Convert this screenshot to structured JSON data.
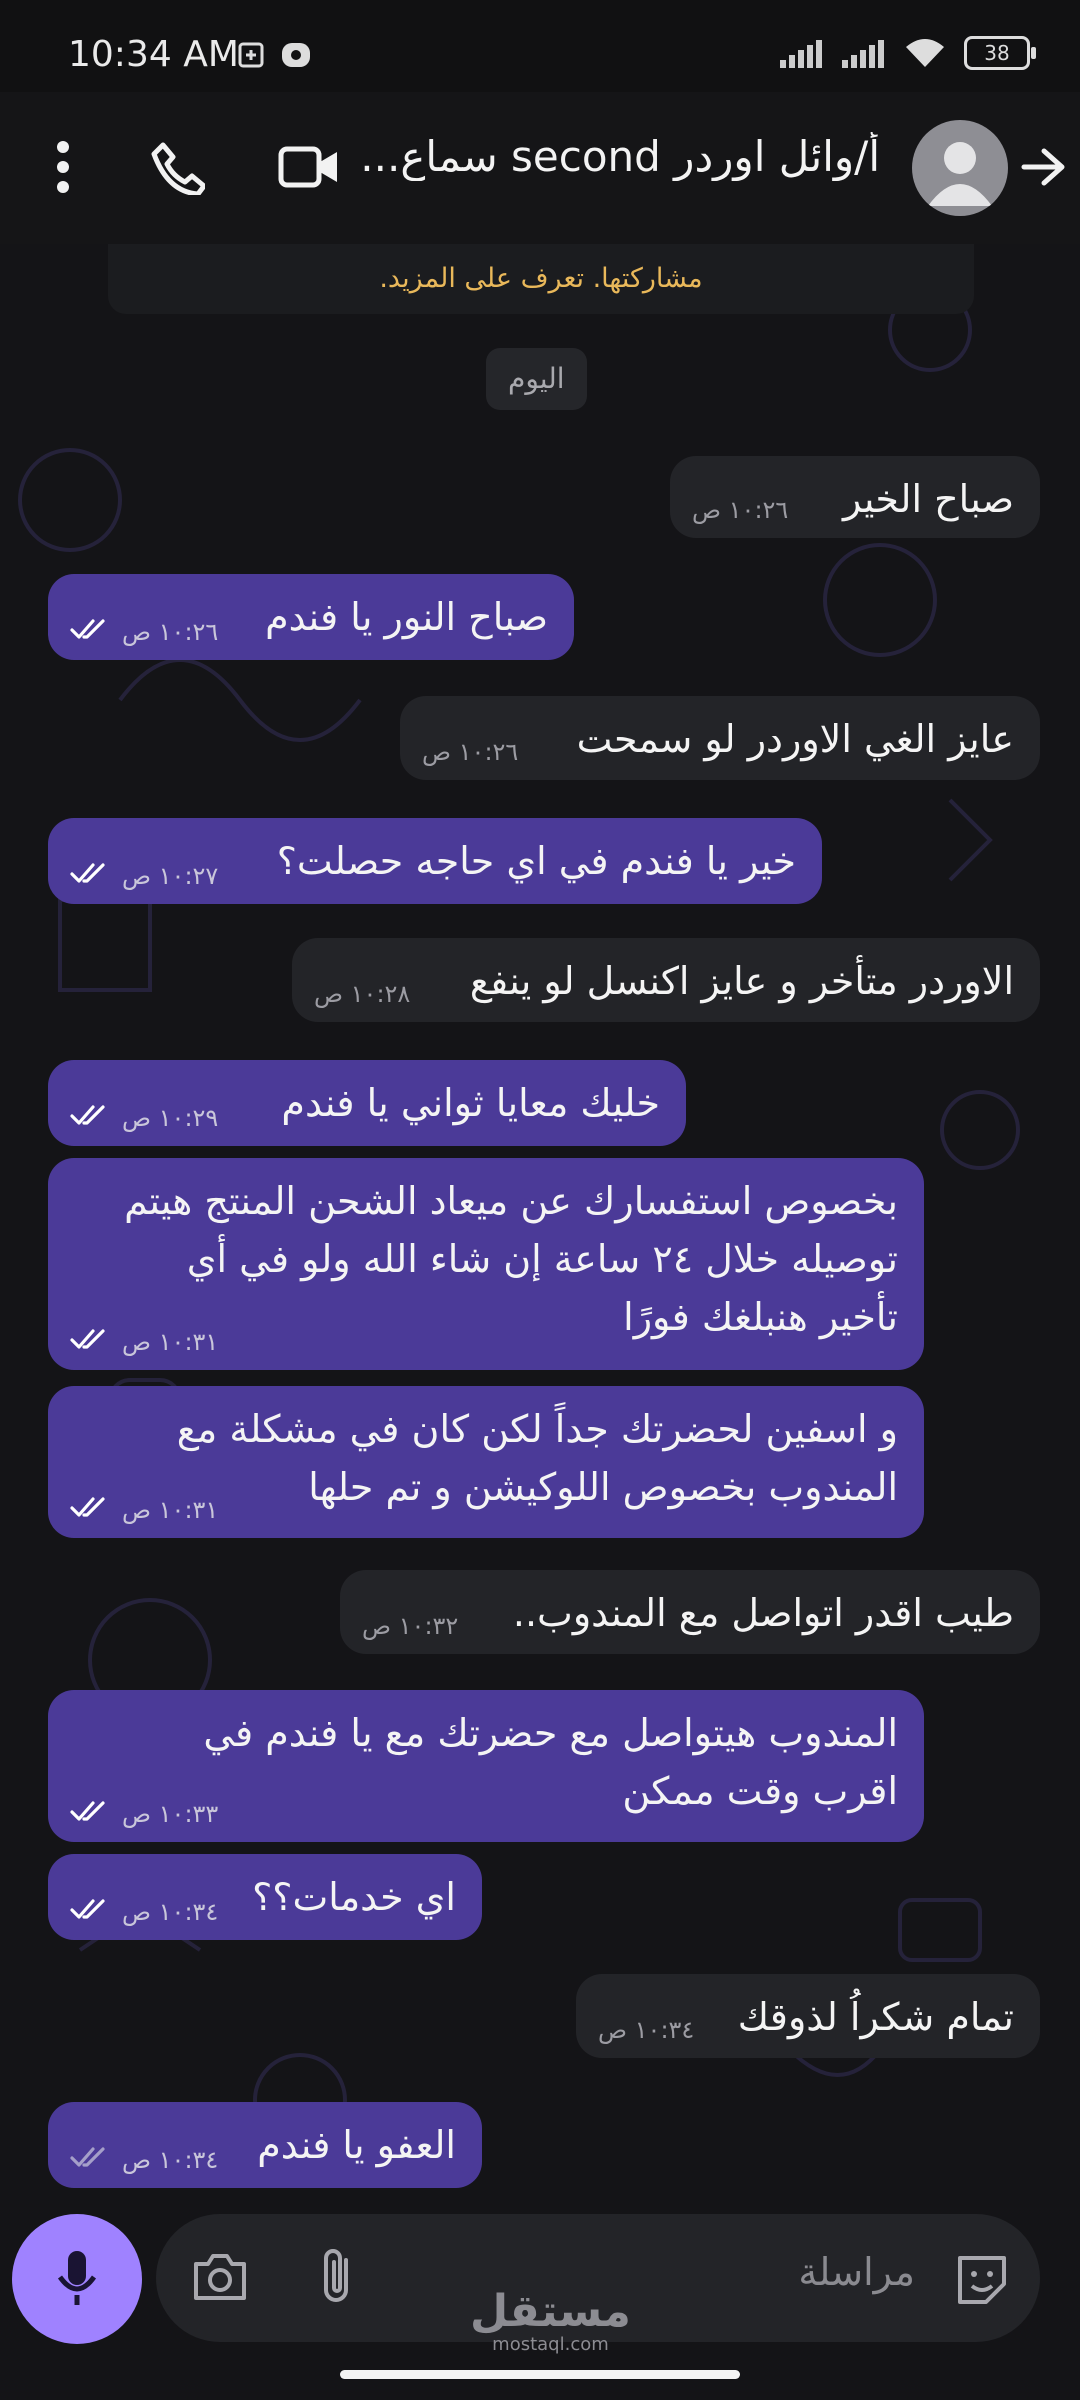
{
  "status_bar": {
    "time": "10:34 AM",
    "battery": "38"
  },
  "header": {
    "contact_name": "أ/وائل اوردر second سماع..."
  },
  "notice": {
    "text": "مشاركتها. تعرف على المزيد."
  },
  "date_chip": "اليوم",
  "messages": [
    {
      "dir": "in",
      "lines": [
        "صباح الخير"
      ],
      "time": "١٠:٢٦ ص"
    },
    {
      "dir": "out",
      "lines": [
        "صباح النور يا فندم"
      ],
      "time": "١٠:٢٦ ص",
      "status": "read"
    },
    {
      "dir": "in",
      "lines": [
        "عايز الغي الاوردر لو سمحت"
      ],
      "time": "١٠:٢٦ ص"
    },
    {
      "dir": "out",
      "lines": [
        "خير يا فندم في اي حاجه حصلت؟"
      ],
      "time": "١٠:٢٧ ص",
      "status": "read"
    },
    {
      "dir": "in",
      "lines": [
        "الاوردر متأخر و عايز اكنسل لو ينفع"
      ],
      "time": "١٠:٢٨ ص"
    },
    {
      "dir": "out",
      "lines": [
        "خليك معايا ثواني يا فندم"
      ],
      "time": "١٠:٢٩ ص",
      "status": "read"
    },
    {
      "dir": "out",
      "lines": [
        "بخصوص استفسارك عن ميعاد الشحن المنتج هيتم",
        "توصيله خلال ٢٤ ساعة إن شاء الله ولو في أي",
        "تأخير هنبلغك فورًا"
      ],
      "time": "١٠:٣١ ص",
      "status": "read"
    },
    {
      "dir": "out",
      "lines": [
        "و اسفين لحضرتك جداً لكن كان في مشكلة مع",
        "المندوب بخصوص اللوكيشن و تم حلها"
      ],
      "time": "١٠:٣١ ص",
      "status": "read"
    },
    {
      "dir": "in",
      "lines": [
        "طيب اقدر اتواصل مع المندوب.."
      ],
      "time": "١٠:٣٢ ص"
    },
    {
      "dir": "out",
      "lines": [
        "المندوب هيتواصل مع حضرتك مع يا فندم في",
        "اقرب وقت ممكن"
      ],
      "time": "١٠:٣٣ ص",
      "status": "read"
    },
    {
      "dir": "out",
      "lines": [
        "اي خدمات؟؟"
      ],
      "time": "١٠:٣٤ ص",
      "status": "read"
    },
    {
      "dir": "in",
      "lines": [
        "تمام شكراُ لذوقك"
      ],
      "time": "١٠:٣٤ ص"
    },
    {
      "dir": "out",
      "lines": [
        "العفو يا فندم"
      ],
      "time": "١٠:٣٤ ص",
      "status": "delivered"
    }
  ],
  "composer": {
    "placeholder": "مراسلة"
  },
  "watermark": {
    "arabic": "مستقل",
    "latin": "mostaql.com"
  },
  "colors": {
    "outgoing": "#4b3a98",
    "incoming": "#232428",
    "mic": "#9f82ff",
    "notice": "#e9b85a"
  }
}
